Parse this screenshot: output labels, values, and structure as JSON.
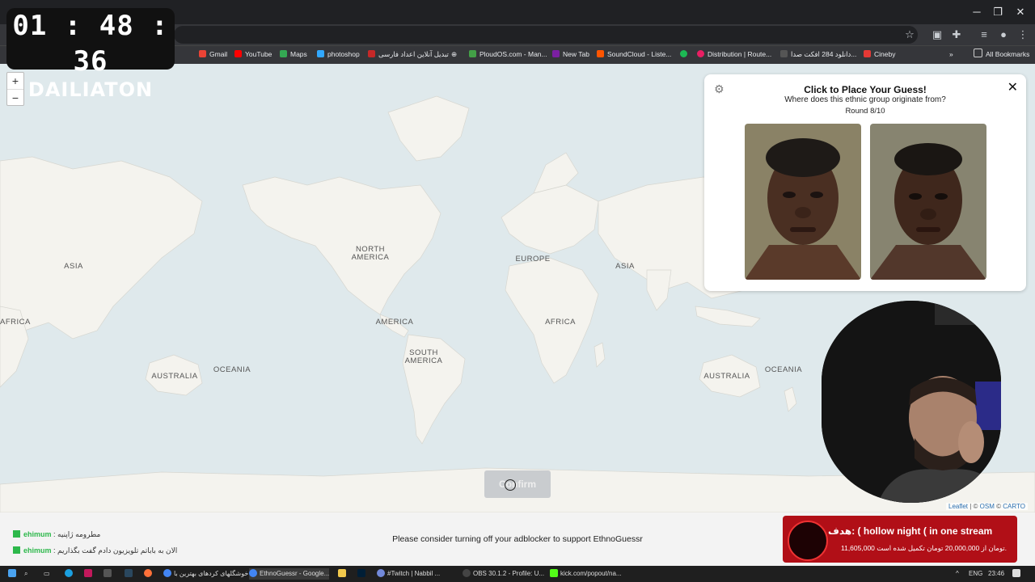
{
  "timer": {
    "time": "01 : 48 : 36",
    "label": "DAILIATON"
  },
  "bookmarks": [
    {
      "label": "Gmail",
      "color": "#ea4335"
    },
    {
      "label": "YouTube",
      "color": "#ff0000"
    },
    {
      "label": "Maps",
      "color": "#34a853"
    },
    {
      "label": "photoshop",
      "color": "#31a8ff"
    },
    {
      "label": "تبدیل آنلاین اعداد فارسی",
      "color": "#c62828"
    },
    {
      "label": "PloudOS.com - Man...",
      "color": "#43a047"
    },
    {
      "label": "New Tab",
      "color": "#7b1fa2"
    },
    {
      "label": "SoundCloud - Liste...",
      "color": "#ff5500"
    },
    {
      "label": "Distribution | Route...",
      "color": "#e91e63"
    },
    {
      "label": "دانلود 284 افکت صدا...",
      "color": "#555555"
    },
    {
      "label": "Cineby",
      "color": "#e53935"
    }
  ],
  "all_bookmarks": "All Bookmarks",
  "map": {
    "labels": [
      "NORTH AMERICA",
      "EUROPE",
      "ASIA",
      "ASIA",
      "AFRICA",
      "AFRICA",
      "AMERICA",
      "SOUTH AMERICA",
      "AUSTRALIA",
      "AUSTRALIA",
      "OCEANIA",
      "OCEANIA"
    ],
    "zoom_in": "+",
    "zoom_out": "−",
    "confirm_label": "Confirm",
    "attribution": {
      "leaflet": "Leaflet",
      "osm": "OSM",
      "carto": "CARTO"
    }
  },
  "panel": {
    "title": "Click to Place Your Guess!",
    "subtitle": "Where does this ethnic group originate from?",
    "round": "Round 8/10",
    "close": "✕",
    "settings_icon": "⚙"
  },
  "footer": {
    "adblock_note": "Please consider turning off your adblocker to support EthnoGuessr",
    "chat": [
      {
        "user": "ehimum",
        "message": ": مطرومه ژاپنیه"
      },
      {
        "user": "ehimum",
        "message": ": الان به باباتم تلویزیون دادم گفت بگذاریم"
      }
    ],
    "banner_title": "هدف: ( hollow night ( in one stream",
    "banner_sub": "11,605,000 تومان از 20,000,000 تومان تکمیل شده است."
  },
  "taskbar": {
    "items": [
      {
        "label": "خوشگلهای کردهای بهترین با",
        "color": "#4285f4"
      },
      {
        "label": "EthnoGuessr - Google...",
        "color": "#4285f4"
      },
      {
        "label": "#Twitch | Nabbil ...",
        "color": "#7289da"
      },
      {
        "label": "OBS 30.1.2 - Profile: U...",
        "color": "#444444"
      },
      {
        "label": "kick.com/popout/na...",
        "color": "#53fc18"
      }
    ],
    "lang": "ENG",
    "clock": "23:46"
  }
}
